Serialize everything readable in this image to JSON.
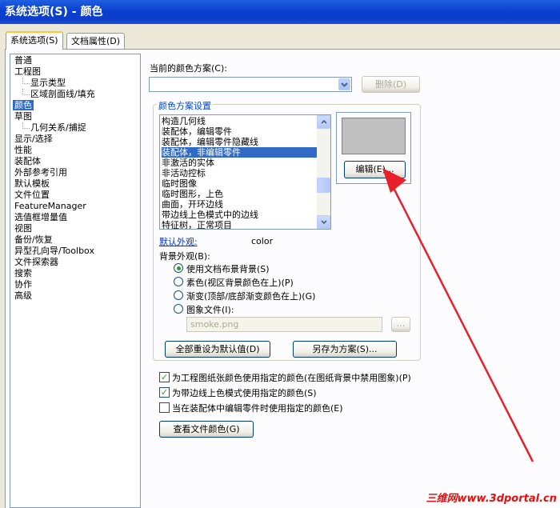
{
  "window": {
    "title": "系统选项(S) - 颜色"
  },
  "tabs": [
    {
      "label": "系统选项(S)",
      "active": true
    },
    {
      "label": "文档属性(D)",
      "active": false
    }
  ],
  "tree": {
    "items": [
      {
        "label": "普通",
        "indent": 0
      },
      {
        "label": "工程图",
        "indent": 0
      },
      {
        "label": "显示类型",
        "indent": 2
      },
      {
        "label": "区域剖面线/填充",
        "indent": 2
      },
      {
        "label": "颜色",
        "indent": 0,
        "selected": true
      },
      {
        "label": "草图",
        "indent": 0
      },
      {
        "label": "几何关系/捕捉",
        "indent": 2
      },
      {
        "label": "显示/选择",
        "indent": 0
      },
      {
        "label": "性能",
        "indent": 0
      },
      {
        "label": "装配体",
        "indent": 0
      },
      {
        "label": "外部参考引用",
        "indent": 0
      },
      {
        "label": "默认模板",
        "indent": 0
      },
      {
        "label": "文件位置",
        "indent": 0
      },
      {
        "label": "FeatureManager",
        "indent": 0
      },
      {
        "label": "选值框增量值",
        "indent": 0
      },
      {
        "label": "视图",
        "indent": 0
      },
      {
        "label": "备份/恢复",
        "indent": 0
      },
      {
        "label": "异型孔向导/Toolbox",
        "indent": 0
      },
      {
        "label": "文件探索器",
        "indent": 0
      },
      {
        "label": "搜索",
        "indent": 0
      },
      {
        "label": "协作",
        "indent": 0
      },
      {
        "label": "高级",
        "indent": 0
      }
    ]
  },
  "scheme": {
    "label": "当前的颜色方案(C):",
    "value": "",
    "delete_button": "删除(D)"
  },
  "settings_group": {
    "title": "颜色方案设置",
    "items": [
      {
        "label": "构造几何线"
      },
      {
        "label": "装配体，编辑零件"
      },
      {
        "label": "装配体，编辑零件隐藏线"
      },
      {
        "label": "装配体，非编辑零件",
        "selected": true
      },
      {
        "label": "非激活的实体"
      },
      {
        "label": "非活动控标"
      },
      {
        "label": "临时图像"
      },
      {
        "label": "临时图形，上色"
      },
      {
        "label": "曲面，开环边线"
      },
      {
        "label": "带边线上色模式中的边线"
      },
      {
        "label": "特征树，正常项目"
      }
    ],
    "preview_color": "#c0c0c0",
    "edit_button": "编辑(E)...",
    "default_appearance_label": "默认外观:",
    "default_appearance_value": "color",
    "background_label": "背景外观(B):",
    "background_options": [
      {
        "label": "使用文档布景背景(S)",
        "checked": true
      },
      {
        "label": "素色(视区背景颜色在上)(P)",
        "checked": false
      },
      {
        "label": "渐变(顶部/底部渐变颜色在上)(G)",
        "checked": false
      },
      {
        "label": "图象文件(I):",
        "checked": false
      }
    ],
    "image_file": "smoke.png",
    "browse_button": "...",
    "reset_button": "全部重设为默认值(D)",
    "save_scheme_button": "另存为方案(S)..."
  },
  "checkboxes": [
    {
      "label": "为工程图纸张颜色使用指定的颜色(在图纸背景中禁用图象)(P)",
      "checked": true
    },
    {
      "label": "为带边线上色模式使用指定的颜色(S)",
      "checked": true
    },
    {
      "label": "当在装配体中编辑零件时使用指定的颜色(E)",
      "checked": false
    }
  ],
  "view_doc_colors_button": "查看文件颜色(G)",
  "watermark": "三维网www.3dportal.cn",
  "colors": {
    "selection": "#316ac5",
    "annotation_arrow": "#e8202a",
    "title_bar": "#0a3fcf"
  }
}
